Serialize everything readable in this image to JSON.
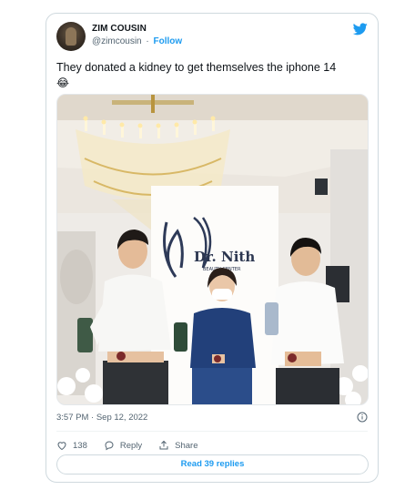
{
  "tweet": {
    "author_name": "ZIM COUSIN",
    "handle": "@zimcousin",
    "separator": "·",
    "follow_label": "Follow",
    "text": "They donated a kidney to get themselves the iphone 14",
    "emoji": "😂",
    "timestamp": "3:57 PM · Sep 12, 2022"
  },
  "photo": {
    "sign_text": "Dr. Nith",
    "sign_subtext": "BEAUTY CENTER"
  },
  "actions": {
    "likes": "138",
    "reply_label": "Reply",
    "share_label": "Share"
  },
  "read_replies_label": "Read 39 replies",
  "colors": {
    "accent": "#1d9bf0",
    "text": "#0f1419",
    "muted": "#536471",
    "border": "#cfd9de"
  }
}
